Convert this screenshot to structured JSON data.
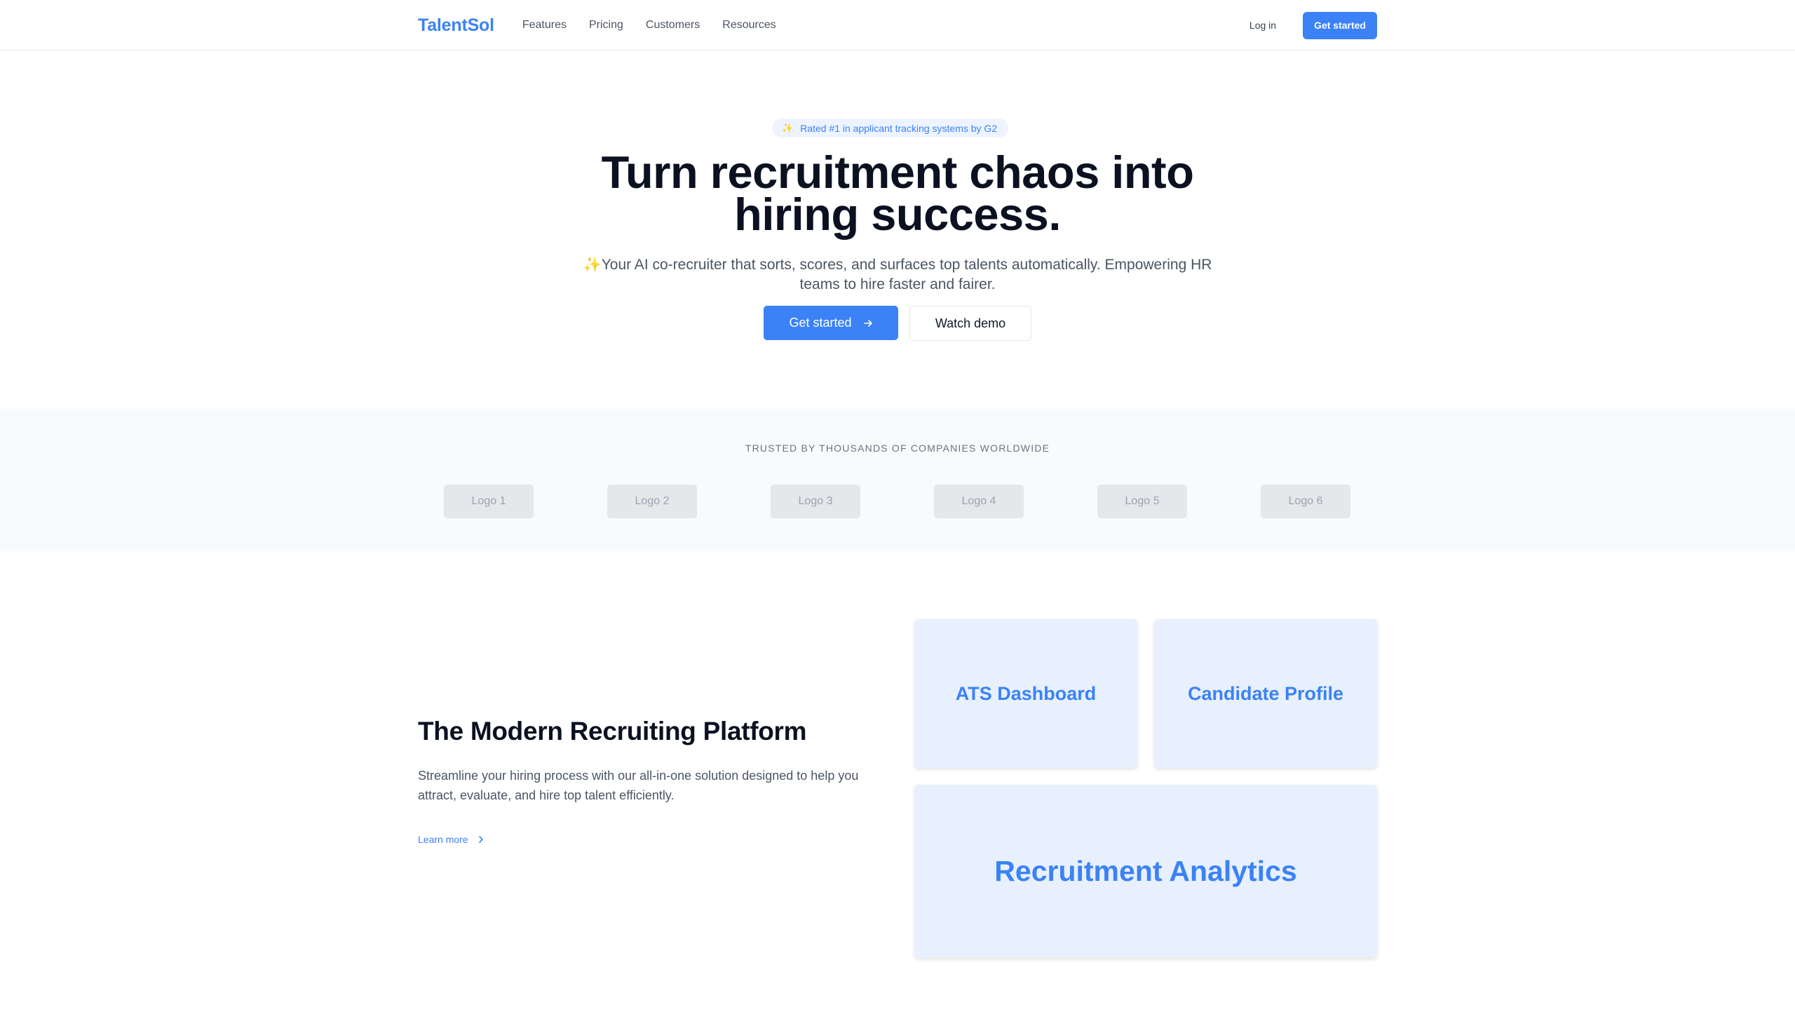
{
  "nav": {
    "brand": "TalentSol",
    "links": [
      "Features",
      "Pricing",
      "Customers",
      "Resources"
    ],
    "login": "Log in",
    "cta": "Get started"
  },
  "hero": {
    "badge_icon": "sparkles-icon",
    "badge_text": "Rated #1 in applicant tracking systems by G2",
    "title_line1": "Turn recruitment chaos into",
    "title_line2": "hiring success.",
    "subtitle_icon": "sparkles-icon",
    "subtitle": "Your AI co-recruiter that sorts, scores, and surfaces top talents automatically. Empowering HR teams to hire faster and fairer.",
    "primary_button": "Get started",
    "secondary_button": "Watch demo"
  },
  "trusted": {
    "label": "TRUSTED BY THOUSANDS OF COMPANIES WORLDWIDE",
    "logos": [
      "Logo 1",
      "Logo 2",
      "Logo 3",
      "Logo 4",
      "Logo 5",
      "Logo 6"
    ]
  },
  "platform": {
    "title": "The Modern Recruiting Platform",
    "description": "Streamline your hiring process with our all-in-one solution designed to help you attract, evaluate, and hire top talent efficiently.",
    "learn_more": "Learn more",
    "cards": [
      "ATS Dashboard",
      "Candidate Profile",
      "Recruitment Analytics"
    ]
  },
  "colors": {
    "accent": "#3b82f6",
    "card_bg": "#e8f0fd",
    "trusted_bg": "#f9fafb"
  }
}
